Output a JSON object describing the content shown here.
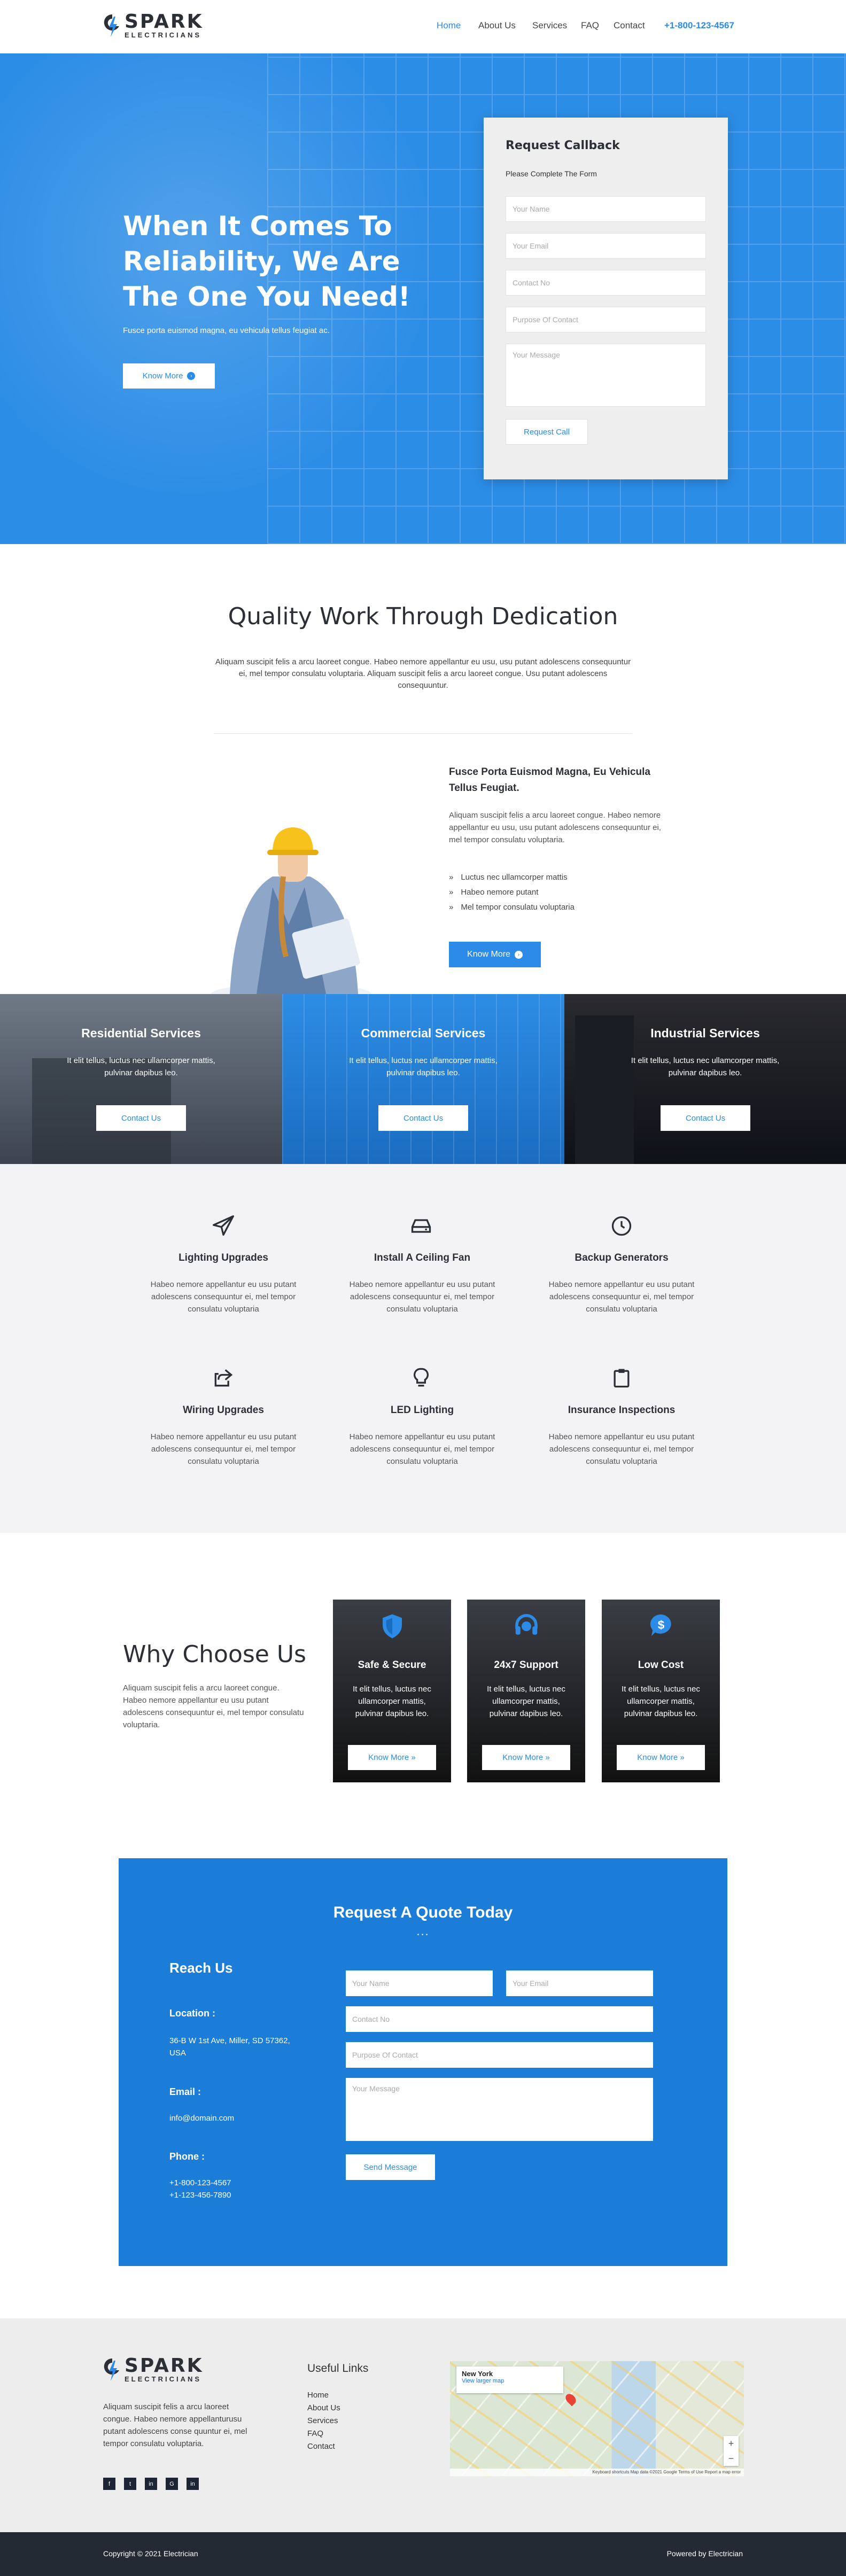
{
  "brand": {
    "name": "SPARK",
    "tagline": "ELECTRICIANS"
  },
  "nav": {
    "items": [
      "Home",
      "About Us",
      "Services",
      "FAQ",
      "Contact"
    ],
    "phone": "+1-800-123-4567"
  },
  "hero": {
    "title": "When It Comes To Reliability, We Are The One You Need!",
    "subtitle": "Fusce porta euismod magna, eu vehicula tellus feugiat ac.",
    "button": "Know More"
  },
  "callback": {
    "title": "Request Callback",
    "subtitle": "Please Complete The Form",
    "name_ph": "Your Name",
    "email_ph": "Your Email",
    "contact_ph": "Contact No",
    "purpose_ph": "Purpose Of Contact",
    "message_ph": "Your Message",
    "button": "Request Call"
  },
  "quality": {
    "title": "Quality Work Through Dedication",
    "text": "Aliquam suscipit felis a arcu laoreet congue. Habeo nemore appellantur eu usu, usu putant adolescens consequuntur ei, mel tempor consulatu voluptaria. Aliquam suscipit felis a arcu laoreet congue. Usu putant adolescens consequuntur.",
    "heading": "Fusce Porta Euismod Magna, Eu Vehicula Tellus Feugiat.",
    "para": "Aliquam suscipit felis a arcu laoreet congue. Habeo nemore appellantur eu usu, usu putant adolescens consequuntur ei, mel tempor consulatu voluptaria.",
    "bullets": [
      "Luctus nec ullamcorper mattis",
      "Habeo nemore putant",
      "Mel tempor consulatu voluptaria"
    ],
    "button": "Know More"
  },
  "services": [
    {
      "title": "Residential Services",
      "text": "It elit tellus, luctus nec ullamcorper mattis, pulvinar dapibus leo.",
      "button": "Contact Us"
    },
    {
      "title": "Commercial Services",
      "text": "It elit tellus, luctus nec ullamcorper mattis, pulvinar dapibus leo.",
      "button": "Contact Us"
    },
    {
      "title": "Industrial Services",
      "text": "It elit tellus, luctus nec ullamcorper mattis, pulvinar dapibus leo.",
      "button": "Contact Us"
    }
  ],
  "features": [
    {
      "title": "Lighting Upgrades",
      "text": "Habeo nemore appellantur eu usu putant adolescens consequuntur ei, mel tempor consulatu voluptaria"
    },
    {
      "title": "Install A Ceiling Fan",
      "text": "Habeo nemore appellantur eu usu putant adolescens consequuntur ei, mel tempor consulatu voluptaria"
    },
    {
      "title": "Backup Generators",
      "text": "Habeo nemore appellantur eu usu putant adolescens consequuntur ei, mel tempor consulatu voluptaria"
    },
    {
      "title": "Wiring Upgrades",
      "text": "Habeo nemore appellantur eu usu putant adolescens consequuntur ei, mel tempor consulatu voluptaria"
    },
    {
      "title": "LED Lighting",
      "text": "Habeo nemore appellantur eu usu putant adolescens consequuntur ei, mel tempor consulatu voluptaria"
    },
    {
      "title": "Insurance Inspections",
      "text": "Habeo nemore appellantur eu usu putant adolescens consequuntur ei, mel tempor consulatu voluptaria"
    }
  ],
  "why": {
    "title": "Why Choose Us",
    "text": "Aliquam suscipit felis a arcu laoreet congue. Habeo nemore appellantur eu usu putant adolescens consequuntur ei, mel tempor consulatu voluptaria.",
    "cards": [
      {
        "title": "Safe & Secure",
        "text": "It elit tellus, luctus nec ullamcorper mattis, pulvinar dapibus leo.",
        "button": "Know More"
      },
      {
        "title": "24x7 Support",
        "text": "It elit tellus, luctus nec ullamcorper mattis, pulvinar dapibus leo.",
        "button": "Know More"
      },
      {
        "title": "Low Cost",
        "text": "It elit tellus, luctus nec ullamcorper mattis, pulvinar dapibus leo.",
        "button": "Know More"
      }
    ]
  },
  "quote": {
    "title": "Request A Quote Today",
    "dots": "...",
    "reach": "Reach Us",
    "location_label": "Location :",
    "location": "36-B W 1st Ave, Miller, SD 57362, USA",
    "email_label": "Email :",
    "email": "info@domain.com",
    "phone_label": "Phone :",
    "phone1": "+1-800-123-4567",
    "phone2": "+1-123-456-7890",
    "name_ph": "Your Name",
    "email_ph": "Your Email",
    "contact_ph": "Contact No",
    "purpose_ph": "Purpose Of Contact",
    "message_ph": "Your Message",
    "button": "Send Message"
  },
  "footer": {
    "about": "Aliquam suscipit felis a arcu laoreet congue. Habeo nemore appellanturusu putant adolescens conse quuntur ei, mel tempor consulatu voluptaria.",
    "links_title": "Useful Links",
    "links": [
      "Home",
      "About Us",
      "Services",
      "FAQ",
      "Contact"
    ],
    "map_place": "New York",
    "map_link": "View larger map",
    "map_footer": "Keyboard shortcuts   Map data ©2021 Google   Terms of Use   Report a map error",
    "social": [
      "f",
      "t",
      "in",
      "G",
      "in"
    ],
    "copyright": "Copyright © 2021 Electrician",
    "powered": "Powered by Electrician"
  },
  "colors": {
    "accent": "#2b8be6",
    "quote_bg": "#1b7dd7",
    "footer_dark": "#232a34"
  }
}
